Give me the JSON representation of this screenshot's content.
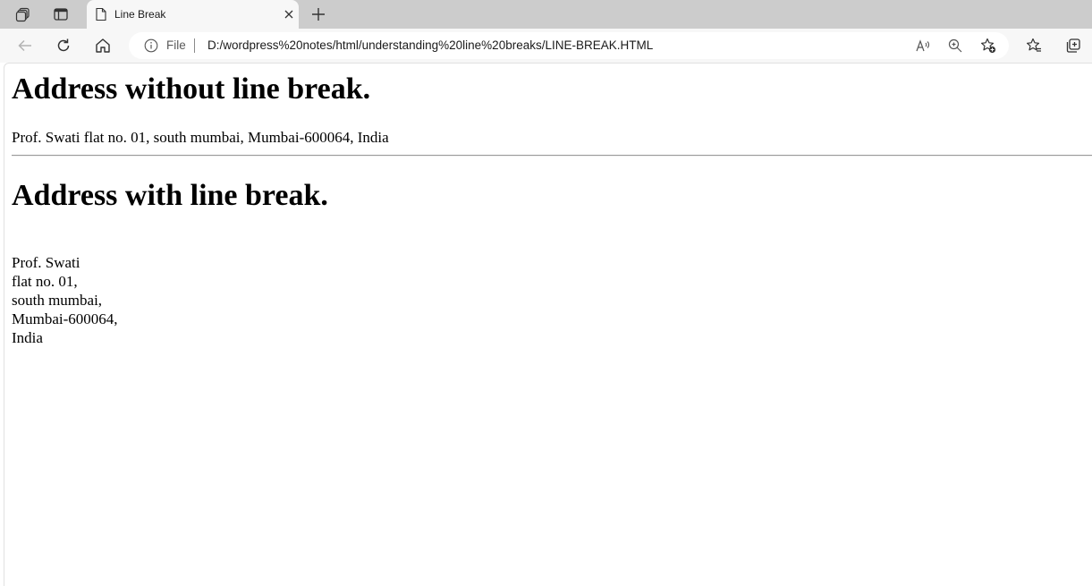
{
  "browser": {
    "tab": {
      "title": "Line Break"
    },
    "address_bar": {
      "scheme_label": "File",
      "url": "D:/wordpress%20notes/html/understanding%20line%20breaks/LINE-BREAK.HTML"
    },
    "icons": {
      "workspaces": "workspaces-icon",
      "vertical_tabs": "vertical-tabs-icon",
      "tab_favicon": "document-icon",
      "close": "close-icon",
      "new_tab": "plus-icon",
      "back": "back-arrow-icon",
      "refresh": "refresh-icon",
      "home": "home-icon",
      "site_info": "info-icon",
      "read_aloud": "read-aloud-icon",
      "zoom": "zoom-icon",
      "add_favorite": "star-plus-icon",
      "favorites": "favorites-icon",
      "collections": "collections-icon"
    }
  },
  "page": {
    "heading_1": "Address without line break.",
    "address_inline": "Prof. Swati flat no. 01, south mumbai, Mumbai-600064, India",
    "heading_2": "Address with line break.",
    "address_lines": [
      "Prof. Swati",
      "flat no. 01,",
      "south mumbai,",
      "Mumbai-600064,",
      "India"
    ]
  }
}
